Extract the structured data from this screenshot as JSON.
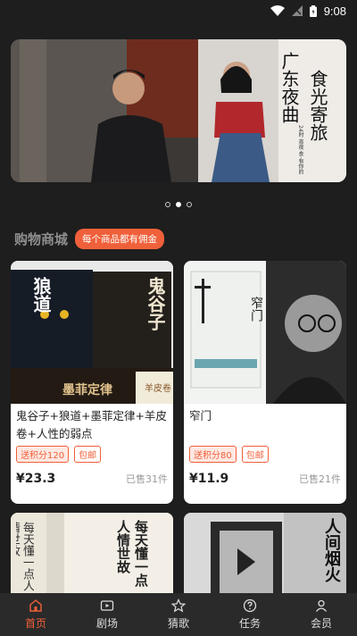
{
  "status": {
    "time": "9:08"
  },
  "banner": {
    "title_vertical": "广东夜曲",
    "subtitle_vertical": "食光寄旅",
    "small_text": "24时 宵夜 食·有你的",
    "carousel_count": 3,
    "carousel_active": 2
  },
  "shop": {
    "title": "购物商城",
    "badge": "每个商品都有佣金"
  },
  "products": [
    {
      "title": "鬼谷子+狼道+墨菲定律+羊皮卷+人性的弱点",
      "points_tag": "送积分120",
      "shipping_tag": "包邮",
      "price": "¥23.3",
      "sold": "已售31件",
      "cover_texts": [
        "狼道",
        "鬼谷子",
        "墨菲定律",
        "羊皮卷"
      ]
    },
    {
      "title": "窄门",
      "points_tag": "送积分80",
      "shipping_tag": "包邮",
      "price": "¥11.9",
      "sold": "已售21件",
      "cover_texts": [
        "窄门"
      ]
    },
    {
      "cover_texts": [
        "每天懂一点人情世故",
        "每天懂一点人情世故"
      ]
    },
    {
      "cover_texts": [
        "人间烟火"
      ]
    }
  ],
  "tabs": [
    {
      "label": "首页",
      "icon": "home-icon",
      "active": true
    },
    {
      "label": "剧场",
      "icon": "theater-icon",
      "active": false
    },
    {
      "label": "猜歌",
      "icon": "star-icon",
      "active": false
    },
    {
      "label": "任务",
      "icon": "question-icon",
      "active": false
    },
    {
      "label": "会员",
      "icon": "user-icon",
      "active": false
    }
  ],
  "colors": {
    "accent": "#f0603a",
    "background": "#1e1e1e",
    "tabbar": "#2a2a2a"
  }
}
